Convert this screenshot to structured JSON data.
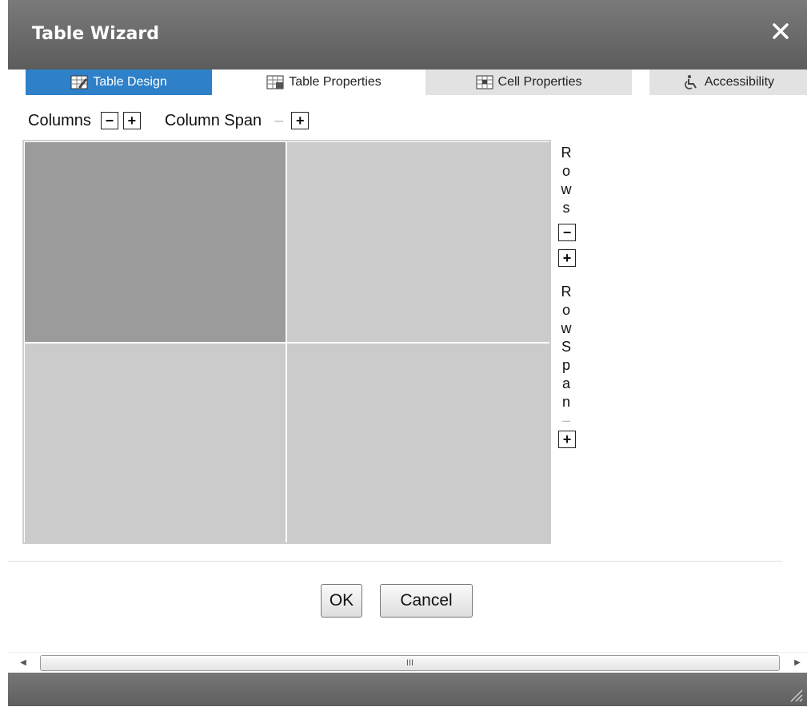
{
  "dialog": {
    "title": "Table Wizard",
    "close_icon": "close-icon"
  },
  "tabs": [
    {
      "label": "Table Design",
      "icon": "table-design-icon",
      "active": true
    },
    {
      "label": "Table Properties",
      "icon": "table-properties-icon",
      "active": false
    },
    {
      "label": "Cell Properties",
      "icon": "cell-properties-icon",
      "active": false
    },
    {
      "label": "Accessibility",
      "icon": "accessibility-icon",
      "active": false
    }
  ],
  "toolbar": {
    "columns_label": "Columns",
    "column_span_label": "Column Span",
    "minus": "−",
    "plus": "+"
  },
  "side": {
    "rows_letters": [
      "R",
      "o",
      "w",
      "s"
    ],
    "rowspan_letters": [
      "R",
      "o",
      "w",
      "S",
      "p",
      "a",
      "n"
    ],
    "minus": "−",
    "plus": "+",
    "disabled_minus": "–"
  },
  "table": {
    "rows": 2,
    "columns": 2,
    "selected_cell": [
      0,
      0
    ]
  },
  "buttons": {
    "ok": "OK",
    "cancel": "Cancel"
  },
  "scrollbar": {
    "grip": "III",
    "left_arrow": "◀",
    "right_arrow": "▶"
  },
  "colors": {
    "titlebar": "#6b6b6b",
    "active_tab": "#2e80c9",
    "selected_cell": "#9b9b9b",
    "cell": "#cbcbcb"
  }
}
